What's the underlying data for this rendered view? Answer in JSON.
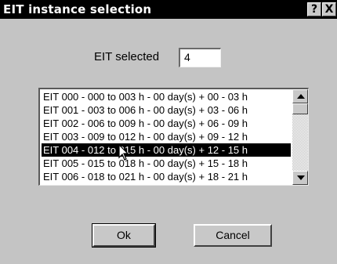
{
  "window": {
    "title": "EIT instance selection",
    "help_label": "?",
    "close_label": "X"
  },
  "selection": {
    "label": "EIT selected",
    "value": "4"
  },
  "list": {
    "selected_index": 4,
    "items": [
      "EIT 000 - 000 to 003 h - 00 day(s) + 00 - 03 h",
      "EIT 001 - 003 to 006 h - 00 day(s) + 03 - 06 h",
      "EIT 002 - 006 to 009 h - 00 day(s) + 06 - 09 h",
      "EIT 003 - 009 to 012 h - 00 day(s) + 09 - 12 h",
      "EIT 004 - 012 to 015 h - 00 day(s) + 12 - 15 h",
      "EIT 005 - 015 to 018 h - 00 day(s) + 15 - 18 h",
      "EIT 006 - 018 to 021 h - 00 day(s) + 18 - 21 h"
    ]
  },
  "buttons": {
    "ok_label": "Ok",
    "cancel_label": "Cancel"
  }
}
